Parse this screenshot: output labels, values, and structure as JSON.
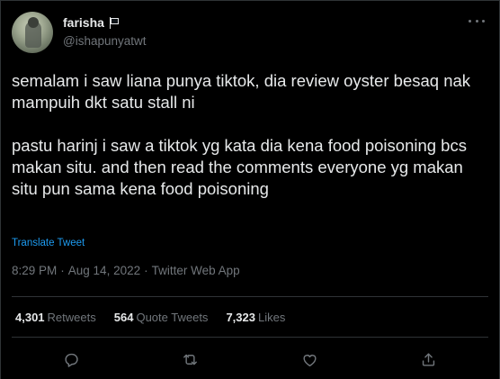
{
  "author": {
    "display_name": "farisha",
    "handle": "@ishapunyatwt",
    "flag_icon": "black-flag-icon"
  },
  "tweet": {
    "paragraphs": [
      "semalam i saw liana punya tiktok, dia review oyster besaq nak mampuih dkt satu stall ni",
      "pastu harinj i saw a tiktok yg kata dia kena food poisoning bcs makan situ. and then read the comments everyone yg makan situ pun sama kena food poisoning"
    ],
    "translate_label": "Translate Tweet"
  },
  "meta": {
    "time": "8:29 PM",
    "date": "Aug 14, 2022",
    "source": "Twitter Web App",
    "separator": "·"
  },
  "stats": {
    "retweets": {
      "count": "4,301",
      "label": "Retweets"
    },
    "quote_tweets": {
      "count": "564",
      "label": "Quote Tweets"
    },
    "likes": {
      "count": "7,323",
      "label": "Likes"
    }
  },
  "actions": [
    "reply-icon",
    "retweet-icon",
    "like-icon",
    "share-icon"
  ],
  "colors": {
    "background": "#000000",
    "text_primary": "#e7e9ea",
    "text_secondary": "#71767b",
    "accent": "#1d9bf0",
    "border": "#2f3336"
  }
}
